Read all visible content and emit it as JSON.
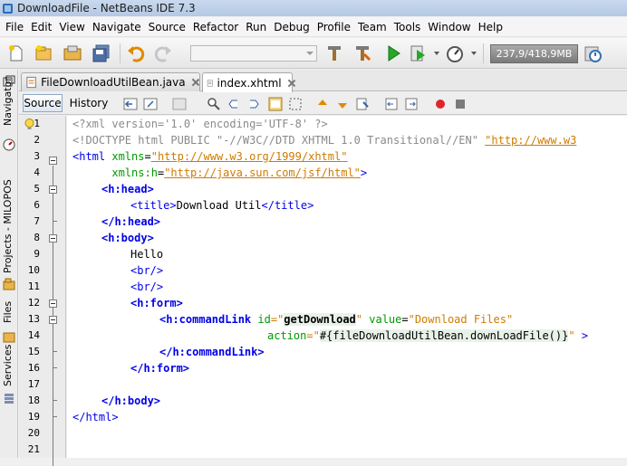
{
  "window": {
    "title": "DownloadFile - NetBeans IDE 7.3"
  },
  "menu": [
    "File",
    "Edit",
    "View",
    "Navigate",
    "Source",
    "Refactor",
    "Run",
    "Debug",
    "Profile",
    "Team",
    "Tools",
    "Window",
    "Help"
  ],
  "toolbar": {
    "memory": "237,9/418,9MB",
    "config_combo_value": ""
  },
  "side_tabs": {
    "navigator": "Navigator",
    "projects": "Projects - MILOPOS",
    "files": "Files",
    "services": "Services"
  },
  "editor_tabs": [
    {
      "label": "FileDownloadUtilBean.java",
      "active": false
    },
    {
      "label": "index.xhtml",
      "active": true
    }
  ],
  "editor_toolbar": {
    "source": "Source",
    "history": "History"
  },
  "line_numbers": [
    "1",
    "2",
    "3",
    "4",
    "5",
    "6",
    "7",
    "8",
    "9",
    "10",
    "11",
    "12",
    "13",
    "14",
    "15",
    "16",
    "17",
    "18",
    "19",
    "20",
    "21"
  ],
  "code": {
    "l1": "<?xml version='1.0' encoding='UTF-8' ?>",
    "l2a": "<!DOCTYPE html PUBLIC \"-//W3C//DTD XHTML 1.0 Transitional//EN\" ",
    "l2b": "\"http://www.w3",
    "l3a": "<html",
    "l3b": " xmlns",
    "l3c": "=",
    "l3d": "\"http://www.w3.org/1999/xhtml\"",
    "l4a": "      xmlns:h",
    "l4b": "=",
    "l4c": "\"http://java.sun.com/jsf/html\"",
    "l4d": ">",
    "l5": "<h:head>",
    "l6a": "<title>",
    "l6b": "Download Util",
    "l6c": "</title>",
    "l7": "</h:head>",
    "l8": "<h:body>",
    "l9": "Hello",
    "l10": "<br/>",
    "l11": "<br/>",
    "l12": "<h:form>",
    "l13a": "<h:commandLink",
    "l13b": " id",
    "l13c": "=\"",
    "l13d": "getDownload",
    "l13e": "\"",
    "l13f": " value",
    "l13g": "=",
    "l13h": "\"Download Files\"",
    "l14a": "action",
    "l14b": "=\"",
    "l14c": "#{fileDownloadUtilBean.downLoadFile()}",
    "l14d": "\"",
    "l14e": " >",
    "l15": "</h:commandLink>",
    "l16": "</h:form>",
    "l18": "</h:body>",
    "l19": "</html>"
  },
  "colors": {
    "tag": "#0000e6",
    "attribute": "#009900",
    "value": "#ce7b00",
    "comment": "#8a8a8a",
    "memory_bg": "#8a8a8a"
  },
  "icons": [
    "app-icon",
    "new-file-icon",
    "new-project-icon",
    "open-project-icon",
    "save-all-icon",
    "undo-icon",
    "redo-icon",
    "clean-build-icon",
    "build-icon",
    "run-icon",
    "debug-icon",
    "profile-icon",
    "gc-icon"
  ]
}
